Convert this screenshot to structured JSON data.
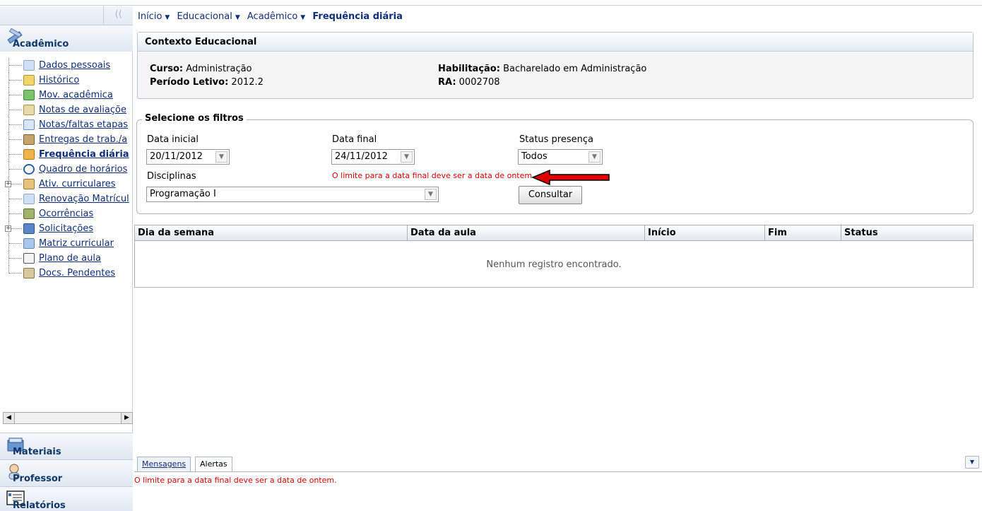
{
  "breadcrumb": {
    "items": [
      "Início",
      "Educacional",
      "Acadêmico"
    ],
    "current": "Frequência diária"
  },
  "sidebar": {
    "collapse_glyph": "⟨⟨",
    "section_academico": "Acadêmico",
    "items": [
      {
        "label": "Dados pessoais",
        "icon": "user-card-icon"
      },
      {
        "label": "Histórico",
        "icon": "pencil-icon"
      },
      {
        "label": "Mov. acadêmica",
        "icon": "arrows-icon"
      },
      {
        "label": "Notas de avaliaçõe",
        "icon": "grades-icon"
      },
      {
        "label": "Notas/faltas etapas",
        "icon": "table-icon"
      },
      {
        "label": "Entregas de trab./a",
        "icon": "box-icon"
      },
      {
        "label": "Frequência diária",
        "icon": "calendar-check-icon"
      },
      {
        "label": "Quadro de horários",
        "icon": "clock-icon"
      },
      {
        "label": "Ativ. curriculares",
        "icon": "activity-icon"
      },
      {
        "label": "Renovação Matrícul",
        "icon": "renew-icon"
      },
      {
        "label": "Ocorrências",
        "icon": "note-icon"
      },
      {
        "label": "Solicitações",
        "icon": "request-icon"
      },
      {
        "label": "Matriz curricular",
        "icon": "matrix-icon"
      },
      {
        "label": "Plano de aula",
        "icon": "book-icon"
      },
      {
        "label": "Docs. Pendentes",
        "icon": "docs-icon"
      }
    ],
    "section_materiais": "Materiais",
    "section_professor": "Professor",
    "section_relatorios": "Relatórios"
  },
  "context": {
    "title": "Contexto Educacional",
    "curso_label": "Curso:",
    "curso_value": "Administração",
    "periodo_label": "Período Letivo:",
    "periodo_value": "2012.2",
    "habilitacao_label": "Habilitação:",
    "habilitacao_value": "Bacharelado em Administração",
    "ra_label": "RA:",
    "ra_value": "0002708"
  },
  "filters": {
    "legend": "Selecione os filtros",
    "data_inicial_label": "Data inicial",
    "data_inicial_value": "20/11/2012",
    "data_final_label": "Data final",
    "data_final_value": "24/11/2012",
    "status_label": "Status presença",
    "status_value": "Todos",
    "disciplinas_label": "Disciplinas",
    "disciplinas_value": "Programação I",
    "error_message": "O limite para a data final deve ser a data de ontem.",
    "consultar_label": "Consultar"
  },
  "grid": {
    "columns": [
      "Dia da semana",
      "Data da aula",
      "Início",
      "Fim",
      "Status"
    ],
    "empty_message": "Nenhum registro encontrado."
  },
  "messages": {
    "tab_mensagens": "Mensagens",
    "tab_alertas": "Alertas",
    "alert_text": "O limite para a data final deve ser a data de ontem."
  },
  "colors": {
    "error": "#e00000",
    "link": "#0f2f7a",
    "header_text": "#0f3868",
    "arrow": "#e00000"
  }
}
